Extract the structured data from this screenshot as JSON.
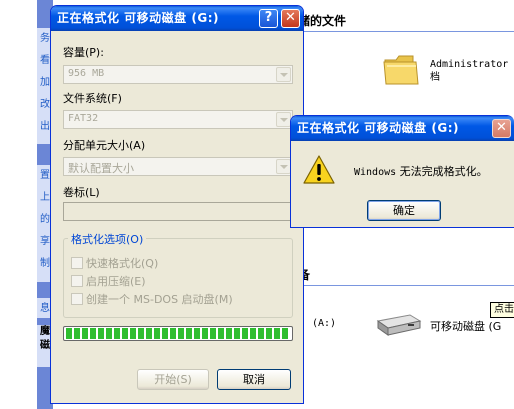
{
  "explorer": {
    "left_strip_1": "务\n看\n加\n改\n出",
    "left_strip_2": "置\n上\n的\n享\n制",
    "left_strip_3": "息",
    "left_strip_4": "魔\n磁",
    "section_files": "储的文件",
    "section_devices": "备",
    "folder_label_line1": "Administrator",
    "folder_label_line2": "档",
    "drive_a_label": "(A:)",
    "drive_g_label": "可移动磁盘 (G",
    "tooltip": "点击"
  },
  "format_dialog": {
    "title": "正在格式化 可移动磁盘 (G:)",
    "help_button": "?",
    "close_button": "✕",
    "capacity_label": "容量(P):",
    "capacity_value": "956 MB",
    "filesystem_label": "文件系统(F)",
    "filesystem_value": "FAT32",
    "alloc_label": "分配单元大小(A)",
    "alloc_value": "默认配置大小",
    "volume_label": "卷标(L)",
    "volume_value": "",
    "options_title": "格式化选项(O)",
    "opt_quick": "快速格式化(Q)",
    "opt_compress": "启用压缩(E)",
    "opt_msdos": "创建一个 MS-DOS 启动盘(M)",
    "progress": 1.0,
    "start_button": "开始(S)",
    "cancel_button": "取消"
  },
  "error_dialog": {
    "title": "正在格式化 可移动磁盘 (G:)",
    "close_button": "✕",
    "message_en": "Windows",
    "message_cn": " 无法完成格式化。",
    "ok_button": "确定"
  },
  "colors": {
    "title_bar": "#0058e6",
    "dialog_face": "#ece9d8",
    "progress_fill": "#2fbe2f",
    "group_title": "#0046d5"
  }
}
